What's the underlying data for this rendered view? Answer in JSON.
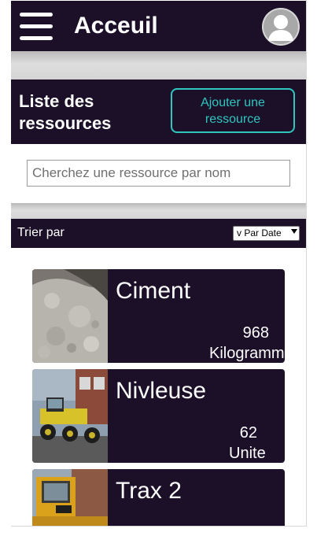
{
  "header": {
    "title": "Acceuil",
    "menu_icon": "hamburger-menu-icon",
    "avatar_icon": "user-avatar-icon"
  },
  "resources_section": {
    "title": "Liste des ressources",
    "add_button": "Ajouter une ressource"
  },
  "search": {
    "placeholder": "Cherchez une ressource par nom",
    "value": ""
  },
  "sort": {
    "label": "Trier par",
    "selected": "v Par Date"
  },
  "resources": [
    {
      "name": "Ciment",
      "quantity": "968",
      "unit": "Kilogramme"
    },
    {
      "name": "Nivleuse",
      "quantity": "62",
      "unit": "Unite"
    },
    {
      "name": "Trax 2",
      "quantity": "",
      "unit": ""
    }
  ],
  "colors": {
    "bar_background": "#1b1028",
    "accent": "#2fc6c0"
  }
}
